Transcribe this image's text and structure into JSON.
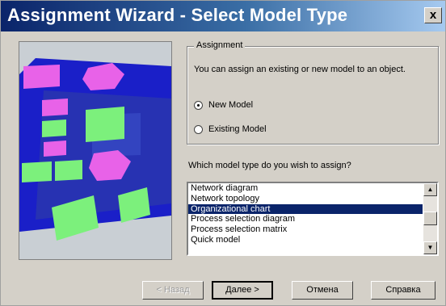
{
  "window": {
    "title": "Assignment Wizard - Select Model Type",
    "close_label": "x"
  },
  "assignment_group": {
    "legend": "Assignment",
    "description": "You can assign an existing or new model to an object.",
    "options": [
      {
        "label": "New Model",
        "selected": true
      },
      {
        "label": "Existing Model",
        "selected": false
      }
    ]
  },
  "model_type": {
    "question": "Which model type do you wish to assign?",
    "items": [
      "Network diagram",
      "Network topology",
      "Organizational chart",
      "Process selection diagram",
      "Process selection matrix",
      "Quick model"
    ],
    "selected_item": "Organizational chart"
  },
  "buttons": {
    "back": "< Назад",
    "next": "Далее >",
    "cancel": "Отмена",
    "help": "Справка"
  },
  "colors": {
    "title_bar": "#0a246a",
    "selection": "#0a246a",
    "dialog_bg": "#d4d0c8"
  }
}
